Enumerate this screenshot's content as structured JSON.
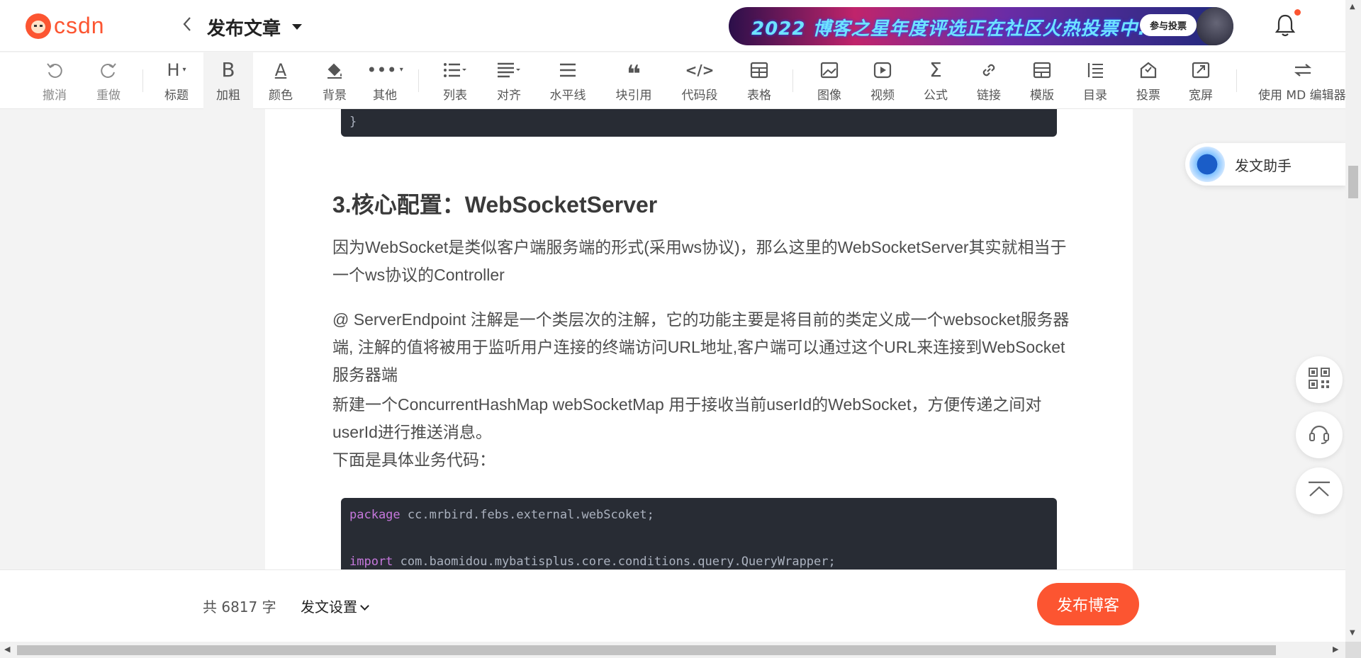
{
  "header": {
    "logo_text": "csdn",
    "title": "发布文章",
    "banner_text": "2022 博客之星年度评选正在社区火热投票中...",
    "banner_button": "参与投票"
  },
  "toolbar": {
    "items": [
      {
        "label": "撤消",
        "icon": "undo-icon"
      },
      {
        "label": "重做",
        "icon": "redo-icon"
      },
      {
        "label": "标题",
        "icon": "heading-icon"
      },
      {
        "label": "加粗",
        "icon": "bold-icon"
      },
      {
        "label": "颜色",
        "icon": "text-color-icon"
      },
      {
        "label": "背景",
        "icon": "paint-bucket-icon"
      },
      {
        "label": "其他",
        "icon": "more-icon"
      },
      {
        "label": "列表",
        "icon": "list-icon"
      },
      {
        "label": "对齐",
        "icon": "align-icon"
      },
      {
        "label": "水平线",
        "icon": "horizontal-rule-icon"
      },
      {
        "label": "块引用",
        "icon": "quote-icon"
      },
      {
        "label": "代码段",
        "icon": "code-icon"
      },
      {
        "label": "表格",
        "icon": "table-icon"
      },
      {
        "label": "图像",
        "icon": "image-icon"
      },
      {
        "label": "视频",
        "icon": "video-icon"
      },
      {
        "label": "公式",
        "icon": "sigma-icon"
      },
      {
        "label": "链接",
        "icon": "link-icon"
      },
      {
        "label": "模版",
        "icon": "template-icon"
      },
      {
        "label": "目录",
        "icon": "toc-icon"
      },
      {
        "label": "投票",
        "icon": "vote-icon"
      },
      {
        "label": "宽屏",
        "icon": "widescreen-icon"
      },
      {
        "label": "使用 MD 编辑器",
        "icon": "switch-editor-icon"
      }
    ]
  },
  "content": {
    "code_top_line1": "}",
    "code_top_line0": "}",
    "heading": "3.核心配置：WebSocketServer",
    "para1": "因为WebSocket是类似客户端服务端的形式(采用ws协议)，那么这里的WebSocketServer其实就相当于一个ws协议的Controller",
    "para2": "@ ServerEndpoint 注解是一个类层次的注解，它的功能主要是将目前的类定义成一个websocket服务器端, 注解的值将被用于监听用户连接的终端访问URL地址,客户端可以通过这个URL来连接到WebSocket服务器端",
    "para3": "新建一个ConcurrentHashMap webSocketMap 用于接收当前userId的WebSocket，方便传递之间对userId进行推送消息。",
    "para4": "下面是具体业务代码：",
    "code_line1_kw": "package",
    "code_line1_rest": " cc.mrbird.febs.external.webScoket;",
    "code_line2_kw": "import",
    "code_line2_rest": " com.baomidou.mybatisplus.core.conditions.query.QueryWrapper;"
  },
  "bottom": {
    "word_count": "共 6817 字",
    "settings_label": "发文设置",
    "publish_label": "发布博客"
  },
  "side": {
    "assistant_label": "发文助手"
  },
  "colors": {
    "brand": "#fc5531",
    "code_bg": "#282c34",
    "keyword": "#c678dd"
  }
}
